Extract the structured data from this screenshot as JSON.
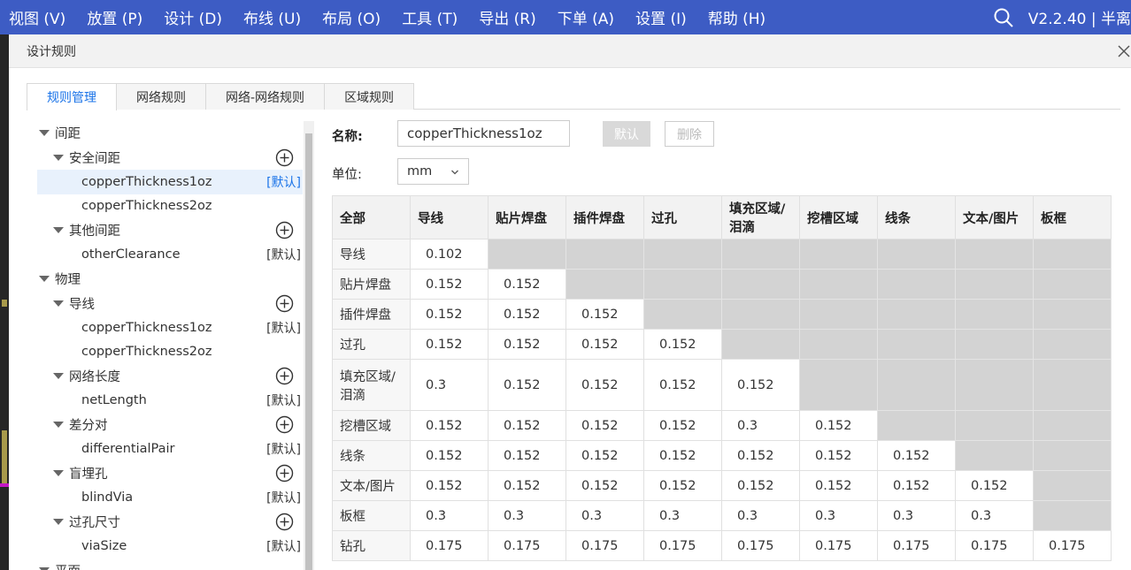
{
  "menu": {
    "items": [
      "视图 (V)",
      "放置 (P)",
      "设计 (D)",
      "布线 (U)",
      "布局 (O)",
      "工具 (T)",
      "导出 (R)",
      "下单 (A)",
      "设置 (I)",
      "帮助 (H)"
    ],
    "version": "V2.2.40 | 半离"
  },
  "dialog": {
    "title": "设计规则",
    "tabs": [
      "规则管理",
      "网络规则",
      "网络-网络规则",
      "区域规则"
    ],
    "active_tab": 0
  },
  "tree": [
    {
      "level": 1,
      "label": "间距",
      "caret": true
    },
    {
      "level": 2,
      "label": "安全间距",
      "caret": true,
      "add": true
    },
    {
      "level": 3,
      "label": "copperThickness1oz",
      "tag": "[默认]",
      "selected": true
    },
    {
      "level": 3,
      "label": "copperThickness2oz"
    },
    {
      "level": 2,
      "label": "其他间距",
      "caret": true,
      "add": true
    },
    {
      "level": 3,
      "label": "otherClearance",
      "tag": "[默认]"
    },
    {
      "level": 1,
      "label": "物理",
      "caret": true
    },
    {
      "level": 2,
      "label": "导线",
      "caret": true,
      "add": true
    },
    {
      "level": 3,
      "label": "copperThickness1oz",
      "tag": "[默认]"
    },
    {
      "level": 3,
      "label": "copperThickness2oz"
    },
    {
      "level": 2,
      "label": "网络长度",
      "caret": true,
      "add": true
    },
    {
      "level": 3,
      "label": "netLength",
      "tag": "[默认]"
    },
    {
      "level": 2,
      "label": "差分对",
      "caret": true,
      "add": true
    },
    {
      "level": 3,
      "label": "differentialPair",
      "tag": "[默认]"
    },
    {
      "level": 2,
      "label": "盲埋孔",
      "caret": true,
      "add": true
    },
    {
      "level": 3,
      "label": "blindVia",
      "tag": "[默认]"
    },
    {
      "level": 2,
      "label": "过孔尺寸",
      "caret": true,
      "add": true
    },
    {
      "level": 3,
      "label": "viaSize",
      "tag": "[默认]"
    },
    {
      "level": 1,
      "label": "平面",
      "caret": true
    }
  ],
  "form": {
    "name_label": "名称:",
    "name_value": "copperThickness1oz",
    "default_button": "默认",
    "delete_button": "删除",
    "unit_label": "单位:",
    "unit_value": "mm"
  },
  "matrix": {
    "corner": "全部",
    "columns": [
      "导线",
      "贴片焊盘",
      "插件焊盘",
      "过孔",
      "填充区域/泪滴",
      "挖槽区域",
      "线条",
      "文本/图片",
      "板框"
    ],
    "rows": [
      {
        "label": "导线",
        "values": [
          "0.102"
        ]
      },
      {
        "label": "贴片焊盘",
        "values": [
          "0.152",
          "0.152"
        ]
      },
      {
        "label": "插件焊盘",
        "values": [
          "0.152",
          "0.152",
          "0.152"
        ]
      },
      {
        "label": "过孔",
        "values": [
          "0.152",
          "0.152",
          "0.152",
          "0.152"
        ]
      },
      {
        "label": "填充区域/泪滴",
        "values": [
          "0.3",
          "0.152",
          "0.152",
          "0.152",
          "0.152"
        ]
      },
      {
        "label": "挖槽区域",
        "values": [
          "0.152",
          "0.152",
          "0.152",
          "0.152",
          "0.3",
          "0.152"
        ]
      },
      {
        "label": "线条",
        "values": [
          "0.152",
          "0.152",
          "0.152",
          "0.152",
          "0.152",
          "0.152",
          "0.152"
        ]
      },
      {
        "label": "文本/图片",
        "values": [
          "0.152",
          "0.152",
          "0.152",
          "0.152",
          "0.152",
          "0.152",
          "0.152",
          "0.152"
        ]
      },
      {
        "label": "板框",
        "values": [
          "0.3",
          "0.3",
          "0.3",
          "0.3",
          "0.3",
          "0.3",
          "0.3",
          "0.3"
        ]
      },
      {
        "label": "钻孔",
        "values": [
          "0.175",
          "0.175",
          "0.175",
          "0.175",
          "0.175",
          "0.175",
          "0.175",
          "0.175",
          "0.175"
        ]
      }
    ]
  },
  "colors": {
    "menubar": "#3d5cc4",
    "accent": "#1a73e8",
    "disabled_cell": "#d3d3d3"
  }
}
